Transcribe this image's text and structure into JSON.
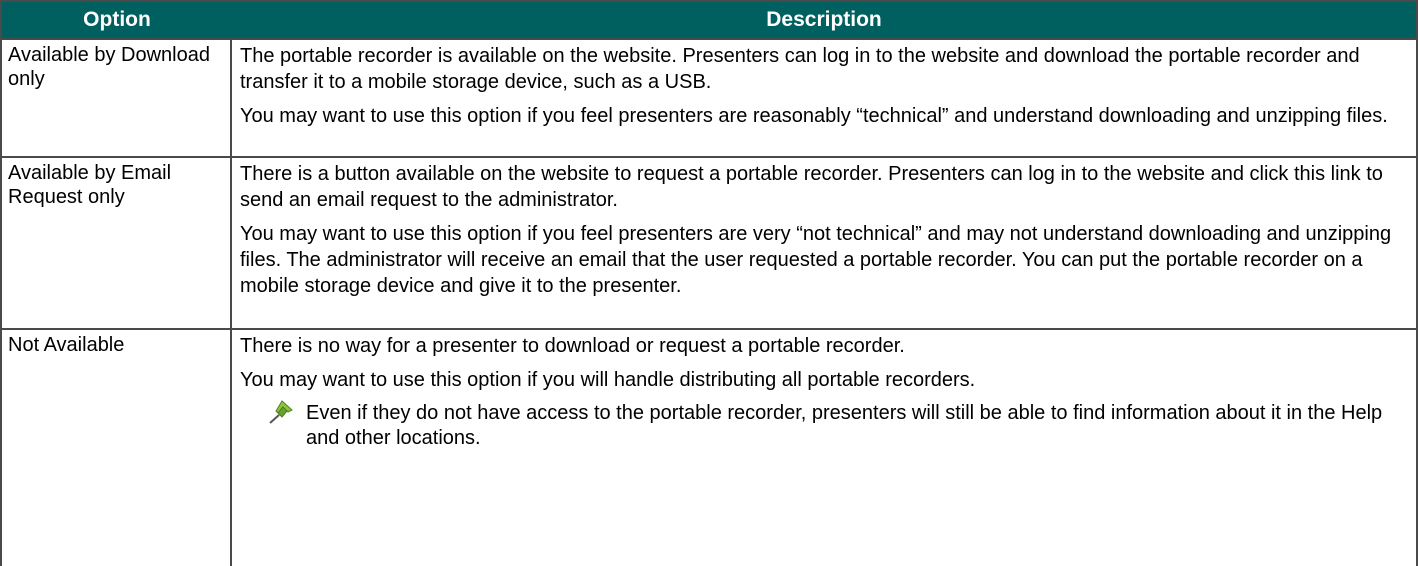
{
  "header": {
    "option": "Option",
    "description": "Description"
  },
  "rows": [
    {
      "option": "Available by Download only",
      "paragraphs": [
        "The portable recorder is available on the website. Presenters can log in to the website and download the portable recorder and transfer it to a mobile storage device, such as a USB.",
        "You may want to use this option if you feel presenters are reasonably “technical” and understand downloading and unzipping files."
      ]
    },
    {
      "option": "Available by Email Request only",
      "paragraphs": [
        "There is a button available on the website to request a portable recorder. Presenters can log in to the website and click this link to send an email request to the administrator.",
        "You may want to use this option if you feel presenters are very “not technical” and may not understand downloading and unzipping files. The administrator will receive an email that the user requested a portable recorder. You can put the portable recorder on a mobile storage device and give it to the presenter."
      ]
    },
    {
      "option": "Not Available",
      "paragraphs": [
        "There is no way for a presenter to download or request a portable recorder.",
        "You may want to use this option if you will handle distributing all portable recorders."
      ],
      "note": {
        "icon": "pushpin-icon",
        "text": "Even if they do not have access to the portable recorder, presenters will still be able to find information about it in the Help and other locations."
      }
    }
  ],
  "colors": {
    "header_bg": "#006060",
    "header_text": "#ffffff",
    "border": "#4a4a4a"
  }
}
